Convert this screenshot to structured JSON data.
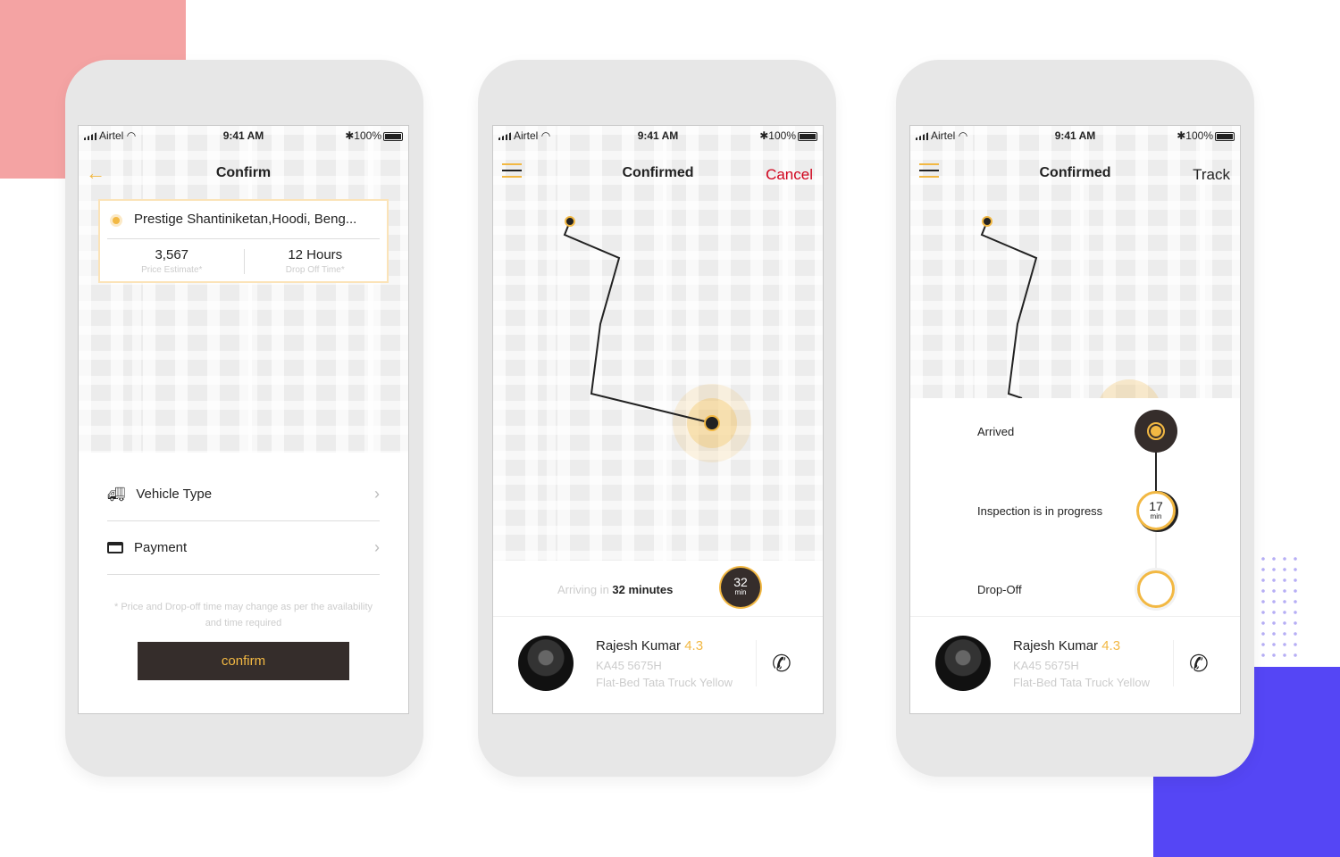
{
  "status": {
    "carrier": "Airtel",
    "time": "9:41 AM",
    "battery": "100%"
  },
  "screen1": {
    "title": "Confirm",
    "address": "Prestige Shantiniketan,Hoodi, Beng...",
    "price": "3,567",
    "price_label": "Price Estimate*",
    "drop_time": "12 Hours",
    "drop_label": "Drop Off Time*",
    "vehicle_type": "Vehicle Type",
    "payment": "Payment",
    "disclaimer": "* Price and Drop-off time may change as per the availability",
    "disclaimer2": "and time required",
    "confirm": "confirm"
  },
  "screen2": {
    "title": "Confirmed",
    "cancel": "Cancel",
    "arriving_prefix": "Arriving in",
    "arriving_value": "32 minutes",
    "timer": "32",
    "timer_unit": "min"
  },
  "screen3": {
    "title": "Confirmed",
    "track": "Track",
    "steps": [
      {
        "label": "Arrived",
        "status": "done"
      },
      {
        "label": "Inspection is in progress",
        "status": "active",
        "timer": "17",
        "unit": "min"
      },
      {
        "label": "Drop-Off",
        "status": "pending"
      }
    ]
  },
  "driver": {
    "name": "Rajesh Kumar",
    "rating": "4.3",
    "plate": "KA45 5675H",
    "vehicle": "Flat-Bed Tata Truck Yellow"
  },
  "colors": {
    "accent": "#f2b843",
    "dark": "#352d2b",
    "cancel": "#d0021b",
    "pink": "#f4a3a3",
    "blue": "#5546f5"
  }
}
